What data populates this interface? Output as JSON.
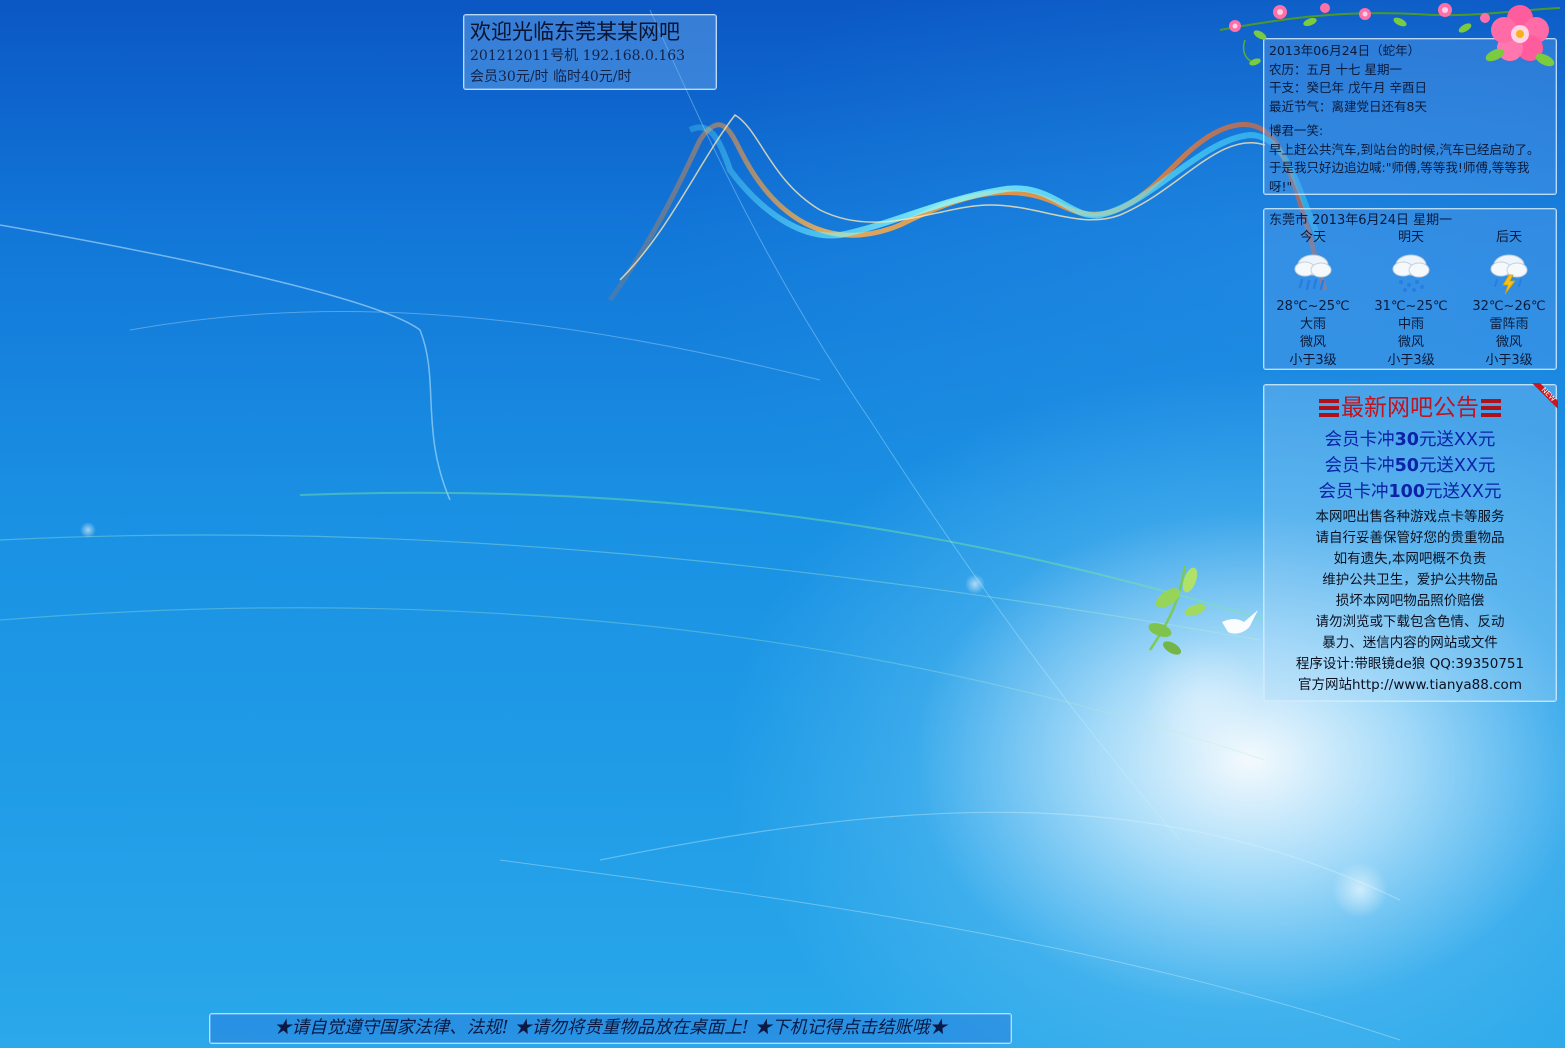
{
  "welcome": {
    "title": "欢迎光临东莞某某网吧",
    "machine_info": "201212011号机 192.168.0.163",
    "pricing": "会员30元/时 临时40元/时"
  },
  "calendar": {
    "date_line": "2013年06月24日（蛇年）",
    "lunar": "农历：五月 十七 星期一",
    "ganzhi": "干支：癸巳年 戊午月 辛酉日",
    "festival": "最近节气：离建党日还有8天",
    "joke_title": "博君一笑:",
    "joke_text": "早上赶公共汽车,到站台的时候,汽车已经启动了。于是我只好边追边喊:\"师傅,等等我!师傅,等等我呀!\""
  },
  "weather": {
    "header": "东莞市 2013年6月24日 星期一",
    "days": [
      {
        "name": "今天",
        "icon": "heavy-rain-icon",
        "temp": "28℃~25℃",
        "condition": "大雨",
        "wind": "微风",
        "level": "小于3级"
      },
      {
        "name": "明天",
        "icon": "moderate-rain-icon",
        "temp": "31℃~25℃",
        "condition": "中雨",
        "wind": "微风",
        "level": "小于3级"
      },
      {
        "name": "后天",
        "icon": "thunderstorm-icon",
        "temp": "32℃~26℃",
        "condition": "雷阵雨",
        "wind": "微风",
        "level": "小于3级"
      }
    ]
  },
  "notice": {
    "title": "最新网吧公告",
    "badge": "NEW",
    "promos": [
      {
        "pre": "会员卡冲",
        "amount": "30",
        "post": "元送XX元"
      },
      {
        "pre": "会员卡冲",
        "amount": "50",
        "post": "元送XX元"
      },
      {
        "pre": "会员卡冲",
        "amount": "100",
        "post": "元送XX元"
      }
    ],
    "rules": [
      "本网吧出售各种游戏点卡等服务",
      "请自行妥善保管好您的贵重物品",
      "如有遗失,本网吧概不负责",
      "维护公共卫生，爱护公共物品",
      "损坏本网吧物品照价赔偿",
      "请勿浏览或下载包含色情、反动",
      "暴力、迷信内容的网站或文件",
      "程序设计:带眼镜de狼 QQ:39350751",
      "官方网站http://www.tianya88.com"
    ]
  },
  "bottom_bar": {
    "text": "★请自觉遵守国家法律、法规! ★请勿将贵重物品放在桌面上! ★下机记得点击结账哦★"
  },
  "colors": {
    "notice_title": "#c0141e",
    "promo_text": "#0c22a8",
    "panel_border": "#d2ebff"
  }
}
